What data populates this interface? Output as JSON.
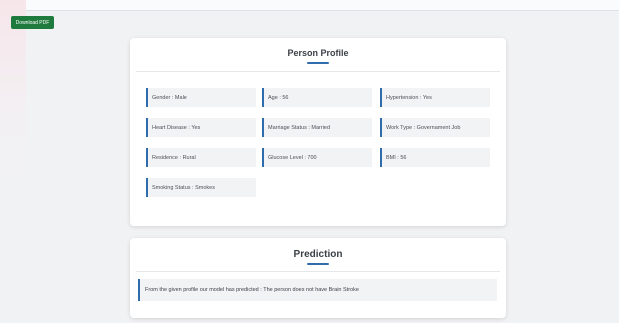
{
  "toolbar": {
    "download_label": "Download PDF"
  },
  "profile": {
    "title": "Person Profile",
    "fields": [
      "Gender : Male",
      "Age : 56",
      "Hypertension : Yes",
      "Heart Disease : Yes",
      "Marriage Status : Married",
      "Work Type : Governament Job",
      "Residence : Rural",
      "Glucose Level : 700",
      "BMI : 56",
      "Smoking Status : Smokes"
    ]
  },
  "prediction": {
    "title": "Prediction",
    "text": "From the given profile our model has predicted : The person does not have Brain Stroke"
  },
  "colors": {
    "accent": "#2f6cab",
    "button": "#1f7a3e",
    "background": "#f1f2f4"
  }
}
